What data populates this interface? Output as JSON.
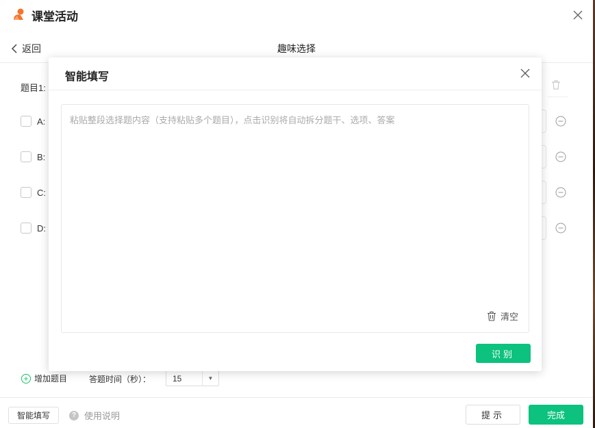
{
  "window": {
    "title": "课堂活动"
  },
  "nav": {
    "back_label": "返回",
    "page_title": "趣味选择"
  },
  "question": {
    "label": "题目1:"
  },
  "options": [
    {
      "letter": "A:"
    },
    {
      "letter": "B:"
    },
    {
      "letter": "C:"
    },
    {
      "letter": "D:"
    }
  ],
  "bottom_bar": {
    "add_question_label": "增加题目",
    "time_label": "答题时间（秒）：",
    "time_value": "15"
  },
  "footer": {
    "smart_fill_label": "智能填写",
    "help_label": "使用说明",
    "hint_label": "提示",
    "done_label": "完成"
  },
  "modal": {
    "title": "智能填写",
    "placeholder": "粘贴整段选择题内容（支持粘贴多个题目），点击识别将自动拆分题干、选项、答案",
    "clear_label": "清空",
    "recognize_label": "识别"
  },
  "colors": {
    "accent": "#0cc27e",
    "logo": "#f4742b"
  }
}
